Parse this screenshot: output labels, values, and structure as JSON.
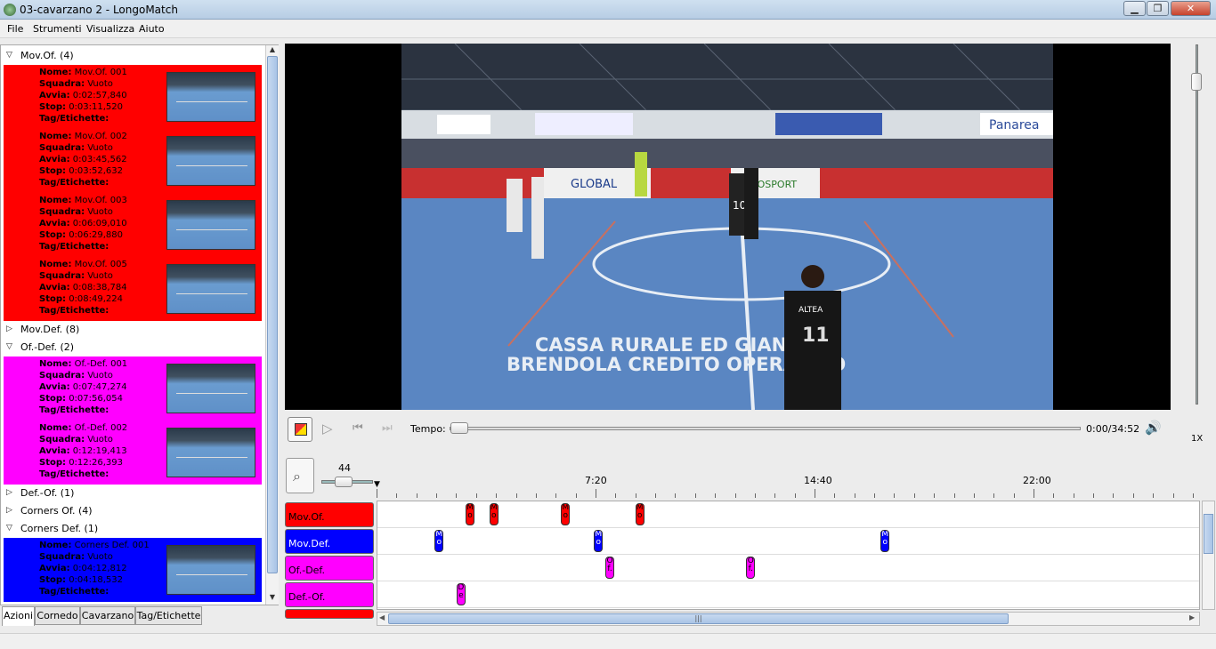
{
  "window": {
    "title": "03-cavarzano 2 - LongoMatch",
    "minimize": "▁",
    "maximize": "❐",
    "close": "✕"
  },
  "menu": [
    {
      "label": "File"
    },
    {
      "label": "Strumenti"
    },
    {
      "label": "Visualizza"
    },
    {
      "label": "Aiuto"
    }
  ],
  "field_labels": {
    "nome": "Nome:",
    "squadra": "Squadra:",
    "avvia": "Avvia:",
    "stop": "Stop:",
    "tag": "Tag/Etichette:"
  },
  "tree": {
    "groups": [
      {
        "label": "Mov.Of. (4)",
        "expanded": true,
        "color": "#ff0000",
        "plays": [
          {
            "nome": "Mov.Of. 001",
            "squadra": "Vuoto",
            "avvia": "0:02:57,840",
            "stop": "0:03:11,520"
          },
          {
            "nome": "Mov.Of. 002",
            "squadra": "Vuoto",
            "avvia": "0:03:45,562",
            "stop": "0:03:52,632"
          },
          {
            "nome": "Mov.Of. 003",
            "squadra": "Vuoto",
            "avvia": "0:06:09,010",
            "stop": "0:06:29,880"
          },
          {
            "nome": "Mov.Of. 005",
            "squadra": "Vuoto",
            "avvia": "0:08:38,784",
            "stop": "0:08:49,224"
          }
        ]
      },
      {
        "label": "Mov.Def. (8)",
        "expanded": false
      },
      {
        "label": "Of.-Def. (2)",
        "expanded": true,
        "color": "#ff00ff",
        "plays": [
          {
            "nome": "Of.-Def. 001",
            "squadra": "Vuoto",
            "avvia": "0:07:47,274",
            "stop": "0:07:56,054"
          },
          {
            "nome": "Of.-Def. 002",
            "squadra": "Vuoto",
            "avvia": "0:12:19,413",
            "stop": "0:12:26,393"
          }
        ]
      },
      {
        "label": "Def.-Of. (1)",
        "expanded": false
      },
      {
        "label": "Corners Of. (4)",
        "expanded": false
      },
      {
        "label": "Corners Def. (1)",
        "expanded": true,
        "color": "#0000ff",
        "plays": [
          {
            "nome": "Corners Def. 001",
            "squadra": "Vuoto",
            "avvia": "0:04:12,812",
            "stop": "0:04:18,532"
          }
        ]
      }
    ]
  },
  "tabs": [
    {
      "label": "Azioni",
      "active": true
    },
    {
      "label": "Cornedo"
    },
    {
      "label": "Cavarzano"
    },
    {
      "label": "Tag/Etichette"
    }
  ],
  "player": {
    "tempo_label": "Tempo:",
    "time": "0:00/34:52",
    "rate": "1X",
    "progress": 0.0
  },
  "timeline": {
    "zoom_value": "44",
    "ruler_labels": [
      "7:20",
      "14:40",
      "22:00"
    ],
    "duration_seconds": 2092,
    "categories": [
      {
        "label": "Mov.Of.",
        "color": "#ff0000",
        "events": [
          {
            "t": 177,
            "label": "M o"
          },
          {
            "t": 225,
            "label": "M o"
          },
          {
            "t": 369,
            "label": "M o"
          },
          {
            "t": 518,
            "label": "M o"
          }
        ]
      },
      {
        "label": "Mov.Def.",
        "color": "#0000ff",
        "events": [
          {
            "t": 115,
            "label": "M o"
          },
          {
            "t": 435,
            "label": "M o"
          },
          {
            "t": 1011,
            "label": "M o"
          }
        ]
      },
      {
        "label": "Of.-Def.",
        "color": "#ff00ff",
        "events": [
          {
            "t": 458,
            "label": "O f."
          },
          {
            "t": 741,
            "label": "O f."
          }
        ]
      },
      {
        "label": "Def.-Of.",
        "color": "#ff00ff",
        "events": [
          {
            "t": 159,
            "label": "D e"
          }
        ]
      }
    ]
  },
  "banners": {
    "line1": "CASSA RURALE ED   GIANA DI",
    "line2": "BRENDOLA CREDITO   OPERATIVO",
    "sponsor1": "GLOBAL",
    "sponsor2": "EUROSPORT",
    "sponsor3": "Panarea",
    "jersey1": "10",
    "jersey2": "11",
    "jersey_name": "ALTEA"
  }
}
